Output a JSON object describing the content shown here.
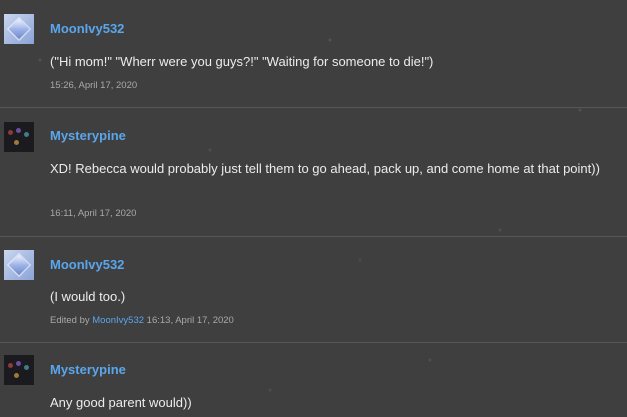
{
  "posts": [
    {
      "username": "MoonIvy532",
      "avatar_icon": "diamond-avatar-icon",
      "message": "(\"Hi mom!\" \"Wherr were you guys?!\" \"Waiting for someone to die!\")",
      "timestamp": "15:26, April 17, 2020"
    },
    {
      "username": "Mysterypine",
      "avatar_icon": "pine-avatar-icon",
      "message": "XD! Rebecca would probably just tell them to go ahead, pack up, and come home at that point))",
      "timestamp": "16:11, April 17, 2020"
    },
    {
      "username": "MoonIvy532",
      "avatar_icon": "diamond-avatar-icon",
      "message": "(I would too.)",
      "edited_prefix": "Edited by",
      "edited_by": "MoonIvy532",
      "timestamp": "16:13, April 17, 2020"
    },
    {
      "username": "Mysterypine",
      "avatar_icon": "pine-avatar-icon",
      "message": "Any good parent would))"
    }
  ],
  "colors": {
    "background": "#3f3f3f",
    "username": "#5aa6ec",
    "text": "#ececec",
    "meta": "#a9a9a9",
    "divider": "#565656"
  }
}
